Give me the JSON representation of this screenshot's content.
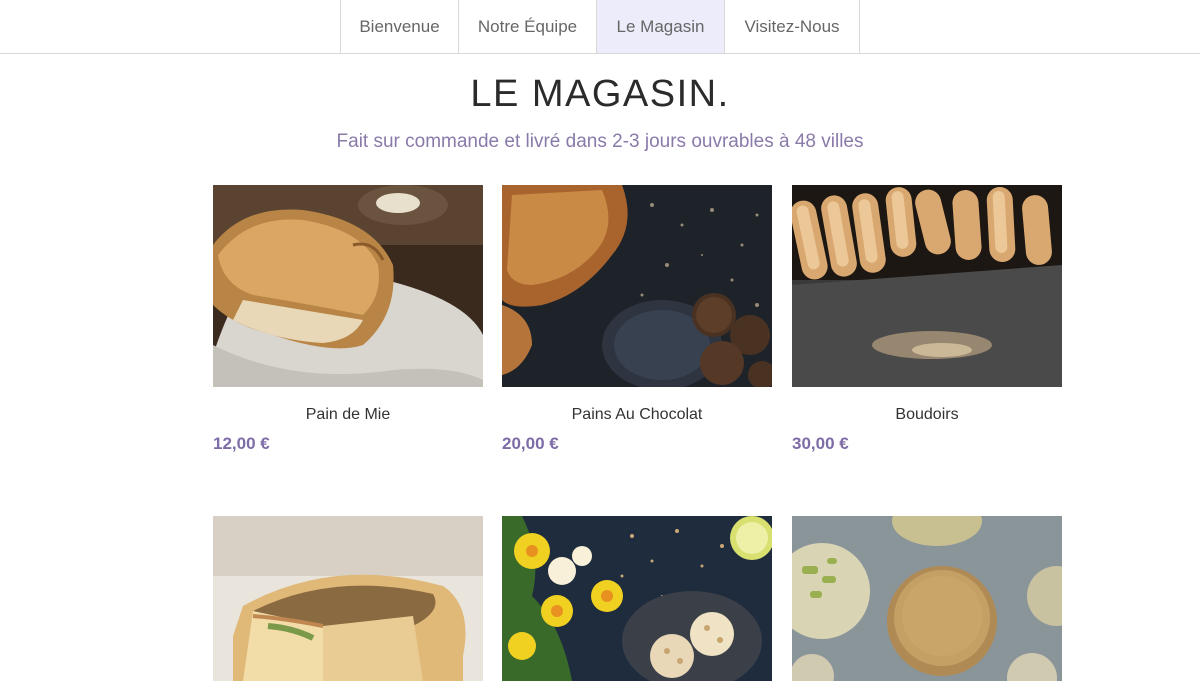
{
  "nav": {
    "items": [
      {
        "label": "Bienvenue"
      },
      {
        "label": "Notre Équipe"
      },
      {
        "label": "Le Magasin",
        "active": true
      },
      {
        "label": "Visitez-Nous"
      }
    ]
  },
  "page": {
    "title": "LE MAGASIN.",
    "subtitle": "Fait sur commande et livré dans 2-3 jours ouvrables à 48 villes"
  },
  "products": [
    {
      "name": "Pain de Mie",
      "price": "12,00 €",
      "image": "bread-loaf-photo"
    },
    {
      "name": "Pains Au Chocolat",
      "price": "20,00 €",
      "image": "croissant-truffles-photo"
    },
    {
      "name": "Boudoirs",
      "price": "30,00 €",
      "image": "ladyfinger-biscuits-photo"
    },
    {
      "name": "",
      "price": "",
      "image": "quiche-photo"
    },
    {
      "name": "",
      "price": "",
      "image": "daffodils-pastries-photo"
    },
    {
      "name": "",
      "price": "",
      "image": "pistachio-cookies-photo"
    }
  ],
  "colors": {
    "accent": "#7d6ca6",
    "subtitle": "#8a7aaa",
    "nav_active_bg": "#ececfa",
    "border": "#d8d8d8"
  }
}
